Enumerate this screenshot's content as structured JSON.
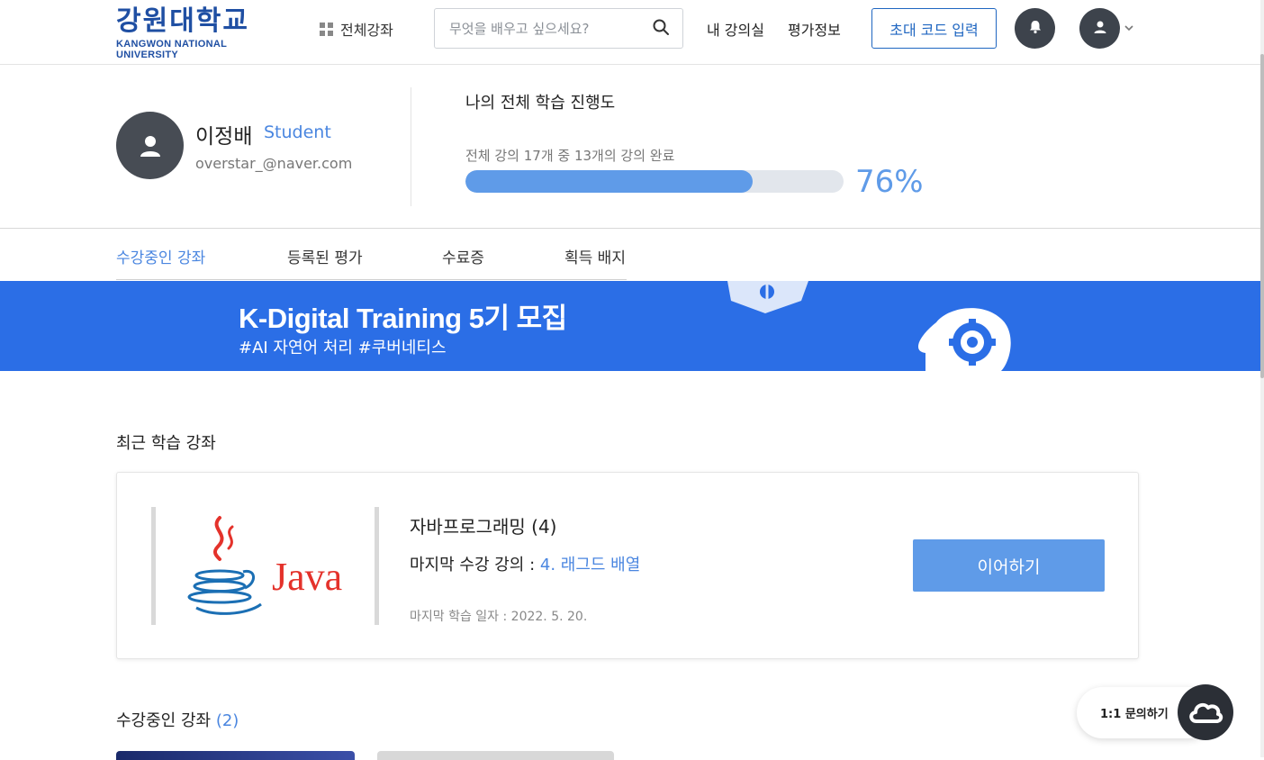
{
  "header": {
    "logo_main": "강원대학교",
    "logo_sub": "KANGWON NATIONAL UNIVERSITY",
    "all_courses": "전체강좌",
    "search_placeholder": "무엇을 배우고 싶으세요?",
    "nav_my_classroom": "내 강의실",
    "nav_eval_info": "평가정보",
    "invite_code": "초대 코드 입력",
    "icons": [
      "grid-icon",
      "search-icon",
      "bell-icon",
      "user-icon",
      "chevron-down-icon"
    ]
  },
  "profile": {
    "name": "이정배",
    "role": "Student",
    "email": "overstar_@naver.com",
    "progress_title": "나의 전체 학습 진행도",
    "progress_sub": "전체 강의 17개 중 13개의 강의 완료",
    "progress_percent_text": "76%",
    "progress_fraction": 0.76
  },
  "tabs": [
    {
      "label": "수강중인 강좌",
      "active": true
    },
    {
      "label": "등록된 평가",
      "active": false
    },
    {
      "label": "수료증",
      "active": false
    },
    {
      "label": "획득 배지",
      "active": false
    }
  ],
  "banner": {
    "title": "K-Digital Training 5기 모집",
    "tags": "#AI 자연어 처리  #쿠버네티스",
    "bg_color": "#2b6ee6"
  },
  "recent": {
    "section_title": "최근 학습 강좌",
    "course_title": "자바프로그래밍 (4)",
    "last_lecture_label": "마지막 수강 강의 : ",
    "last_lecture_value": "4. 래그드 배열",
    "last_date": "마지막 학습 일자 : 2022. 5. 20.",
    "continue_button": "이어하기",
    "thumb_logo_text": "Java"
  },
  "enrolled": {
    "title": "수강중인 강좌",
    "count": "(2)"
  },
  "chat": {
    "label": "1:1 문의하기"
  },
  "colors": {
    "accent": "#4a86e0",
    "primary_blue": "#1f66c1",
    "progress_fill": "#5f9be8",
    "dark": "#3d434c"
  }
}
